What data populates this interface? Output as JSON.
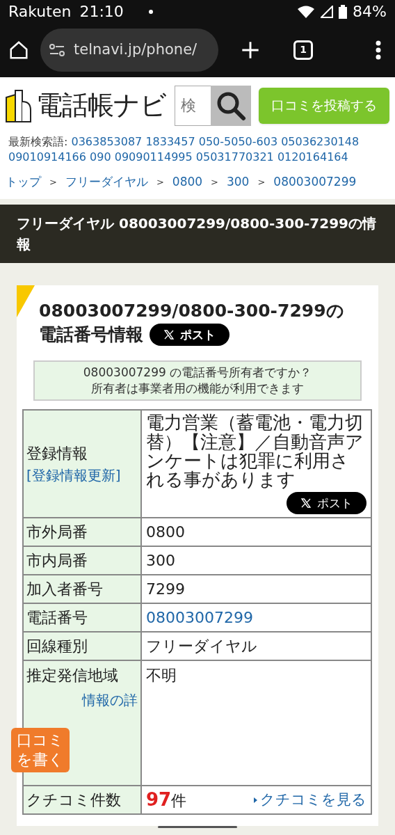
{
  "status_bar": {
    "carrier": "Rakuten",
    "time": "21:10",
    "battery": "84%"
  },
  "browser": {
    "url": "telnavi.jp/phone/",
    "tab_count": "1"
  },
  "header": {
    "logo": "電話帳ナビ",
    "search": {
      "placeholder": "検"
    },
    "post_button": "口コミを投稿する"
  },
  "recent_searches": {
    "label": "最新検索語:",
    "links": [
      "0363853087",
      "1833457",
      "050-5050-603",
      "05036230148",
      "09010914166",
      "090",
      "09090114995",
      "05031770321",
      "0120164164"
    ]
  },
  "breadcrumb": {
    "separator": ">",
    "items": [
      "トップ",
      "フリーダイヤル",
      "0800",
      "300",
      "08003007299"
    ]
  },
  "page_title": "フリーダイヤル 08003007299/0800-300-7299の情報",
  "card": {
    "title": "08003007299/0800-300-7299の電話番号情報",
    "share_button": "ポスト",
    "owner_notice": [
      "08003007299 の電話番号所有者ですか？",
      "所有者は事業者用の機能が利用できます"
    ],
    "rows": [
      {
        "kind": "info",
        "label": "登録情報",
        "label_link": "[登録情報更新]",
        "value": "電力営業（蓄電池・電力切替）【注意】／自動音声アンケートは犯罪に利用される事があります",
        "share_button": "ポスト"
      },
      {
        "kind": "plain",
        "label": "市外局番",
        "value": "0800"
      },
      {
        "kind": "plain",
        "label": "市内局番",
        "value": "300"
      },
      {
        "kind": "plain",
        "label": "加入者番号",
        "value": "7299"
      },
      {
        "kind": "link",
        "label": "電話番号",
        "value": "08003007299"
      },
      {
        "kind": "plain",
        "label": "回線種別",
        "value": "フリーダイヤル"
      },
      {
        "kind": "region",
        "label": "推定発信地域",
        "label_link": "情報の詳",
        "value": "不明"
      },
      {
        "kind": "count",
        "label": "クチコミ件数",
        "count": "97",
        "unit": "件",
        "link": "クチコミを見る"
      }
    ]
  },
  "floating_button": [
    "口コミ",
    "を書く"
  ]
}
